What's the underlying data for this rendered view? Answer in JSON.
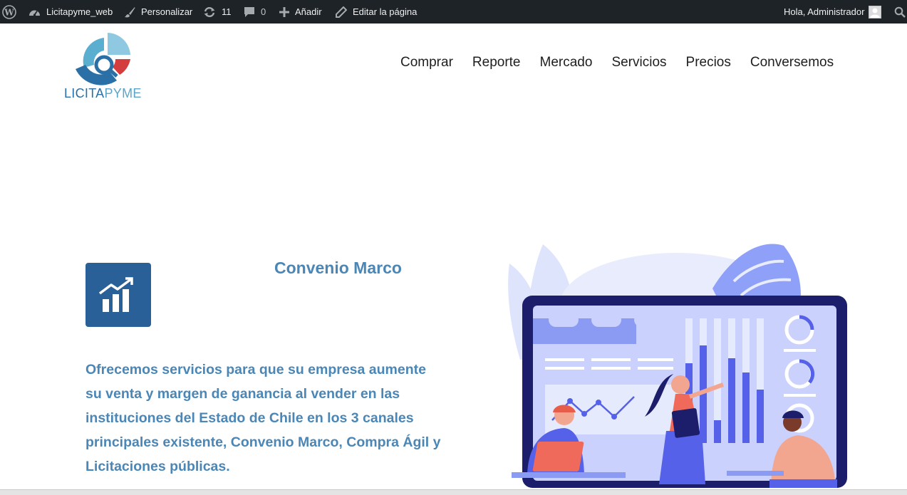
{
  "admin_bar": {
    "site_name": "Licitapyme_web",
    "customize_label": "Personalizar",
    "updates_count": "11",
    "comments_count": "0",
    "new_label": "Añadir",
    "edit_label": "Editar la página",
    "greeting": "Hola, Administrador",
    "icons": [
      "wordpress-icon",
      "dashboard-icon",
      "brush-icon",
      "updates-icon",
      "comment-icon",
      "plus-icon",
      "pencil-icon",
      "avatar",
      "search-icon"
    ]
  },
  "logo": {
    "text_part1": "LICITA",
    "text_part2": "PYME"
  },
  "nav": {
    "items": [
      "Comprar",
      "Reporte",
      "Mercado",
      "Servicios",
      "Precios",
      "Conversemos"
    ]
  },
  "service": {
    "title": "Convenio Marco",
    "description": "Ofrecemos servicios para que su empresa aumente su venta y margen de ganancia al vender en las instituciones del Estado de Chile en los 3 canales principales existente, Convenio Marco, Compra Ágil y Licitaciones públicas.",
    "icon": "growth-chart-icon"
  },
  "colors": {
    "admin_bar_bg": "#1d2327",
    "brand_blue": "#2a6098",
    "text_blue": "#4a86b6",
    "illustration_primary": "#5561e8",
    "illustration_navy": "#1c1e6b"
  }
}
